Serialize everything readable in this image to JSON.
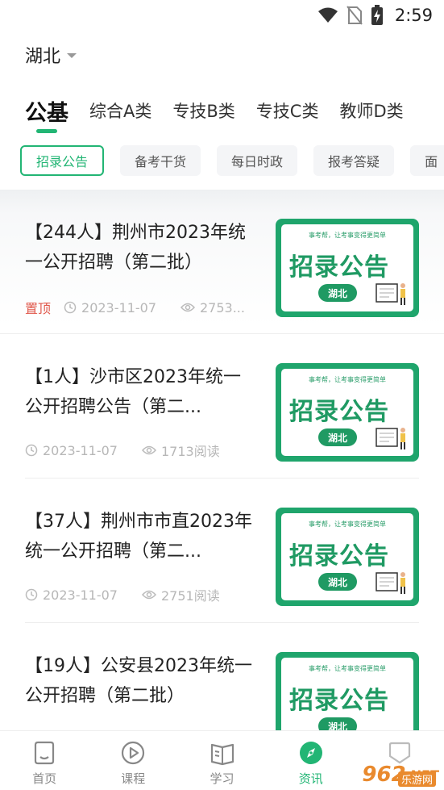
{
  "status_bar": {
    "time": "2:59"
  },
  "region": {
    "label": "湖北"
  },
  "category_tabs": [
    {
      "label": "公基",
      "active": true
    },
    {
      "label": "综合A类",
      "active": false
    },
    {
      "label": "专技B类",
      "active": false
    },
    {
      "label": "专技C类",
      "active": false
    },
    {
      "label": "教师D类",
      "active": false
    }
  ],
  "chips": [
    {
      "label": "招录公告",
      "active": true
    },
    {
      "label": "备考干货",
      "active": false
    },
    {
      "label": "每日时政",
      "active": false
    },
    {
      "label": "报考答疑",
      "active": false
    },
    {
      "label": "面",
      "active": false
    }
  ],
  "articles": [
    {
      "title": "【244人】荆州市2023年统一公开招聘（第二批）",
      "pinned": "置顶",
      "date": "2023-11-07",
      "views": "2753..."
    },
    {
      "title": "【1人】沙市区2023年统一公开招聘公告（第二...",
      "pinned": "",
      "date": "2023-11-07",
      "views": "1713阅读"
    },
    {
      "title": "【37人】荆州市市直2023年统一公开招聘（第二...",
      "pinned": "",
      "date": "2023-11-07",
      "views": "2751阅读"
    },
    {
      "title": "【19人】公安县2023年统一公开招聘（第二批）",
      "pinned": "",
      "date": "",
      "views": ""
    }
  ],
  "thumbnail": {
    "slogan": "事考帮，让考事变得更简单",
    "title": "招录公告",
    "badge": "湖北"
  },
  "bottom_nav": [
    {
      "label": "首页",
      "icon": "home-icon",
      "active": false
    },
    {
      "label": "课程",
      "icon": "play-icon",
      "active": false
    },
    {
      "label": "学习",
      "icon": "book-icon",
      "active": false
    },
    {
      "label": "资讯",
      "icon": "compass-icon",
      "active": true
    },
    {
      "label": "",
      "icon": "profile-icon",
      "active": false
    }
  ],
  "watermark": {
    "text": "962",
    "suffix": ".NET",
    "sub": "乐游网"
  },
  "colors": {
    "accent": "#22b574",
    "pinned": "#e0584b",
    "thumb_green": "#1fa56c"
  }
}
